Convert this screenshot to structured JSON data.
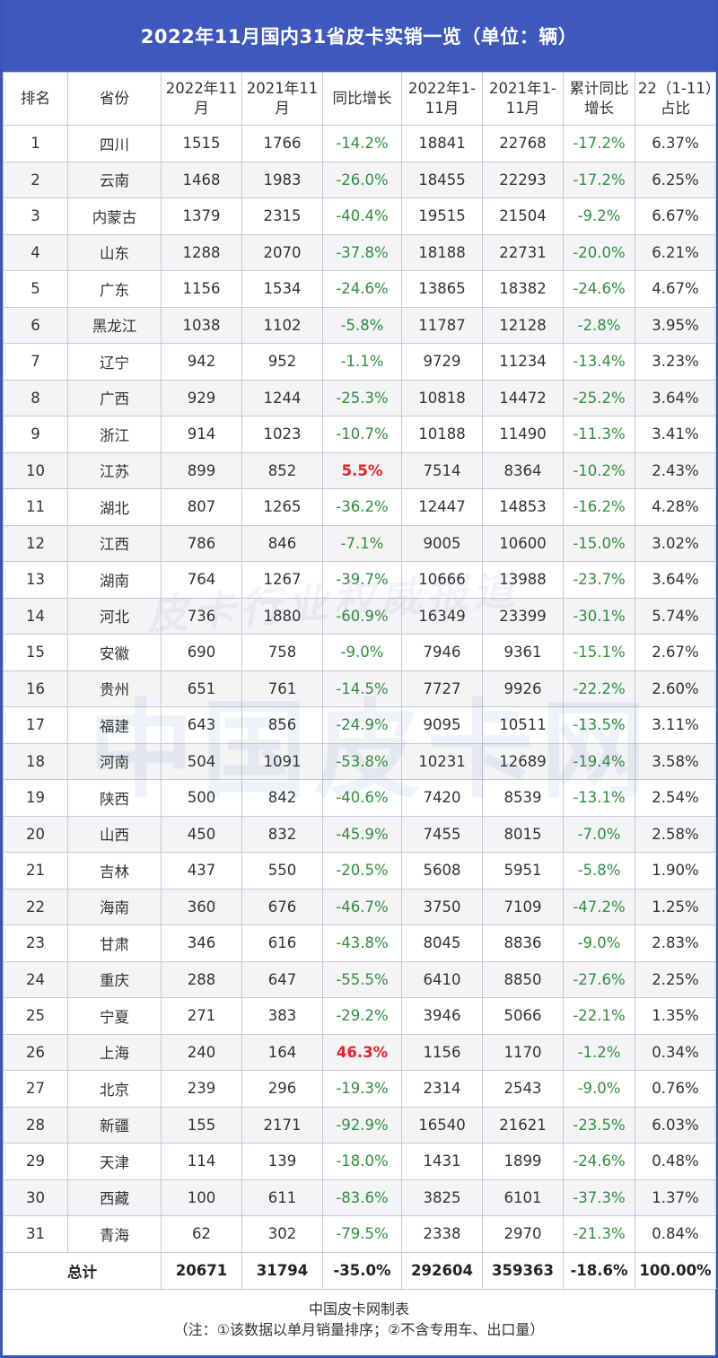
{
  "title": "2022年11月国内31省皮卡实销一览（单位：辆）",
  "headers": [
    "排名",
    "省份",
    "2022年11月",
    "2021年11月",
    "同比增长",
    "2022年1-11月",
    "2021年1-11月",
    "累计同比增长",
    "22（1-11）占比"
  ],
  "rows": [
    {
      "rank": "1",
      "province": "四川",
      "nov22": "1515",
      "nov21": "1766",
      "yoy": "-14.2%",
      "ytd22": "18841",
      "ytd21": "22768",
      "ytd_yoy": "-17.2%",
      "share": "6.37%"
    },
    {
      "rank": "2",
      "province": "云南",
      "nov22": "1468",
      "nov21": "1983",
      "yoy": "-26.0%",
      "ytd22": "18455",
      "ytd21": "22293",
      "ytd_yoy": "-17.2%",
      "share": "6.25%"
    },
    {
      "rank": "3",
      "province": "内蒙古",
      "nov22": "1379",
      "nov21": "2315",
      "yoy": "-40.4%",
      "ytd22": "19515",
      "ytd21": "21504",
      "ytd_yoy": "-9.2%",
      "share": "6.67%"
    },
    {
      "rank": "4",
      "province": "山东",
      "nov22": "1288",
      "nov21": "2070",
      "yoy": "-37.8%",
      "ytd22": "18188",
      "ytd21": "22731",
      "ytd_yoy": "-20.0%",
      "share": "6.21%"
    },
    {
      "rank": "5",
      "province": "广东",
      "nov22": "1156",
      "nov21": "1534",
      "yoy": "-24.6%",
      "ytd22": "13865",
      "ytd21": "18382",
      "ytd_yoy": "-24.6%",
      "share": "4.67%"
    },
    {
      "rank": "6",
      "province": "黑龙江",
      "nov22": "1038",
      "nov21": "1102",
      "yoy": "-5.8%",
      "ytd22": "11787",
      "ytd21": "12128",
      "ytd_yoy": "-2.8%",
      "share": "3.95%"
    },
    {
      "rank": "7",
      "province": "辽宁",
      "nov22": "942",
      "nov21": "952",
      "yoy": "-1.1%",
      "ytd22": "9729",
      "ytd21": "11234",
      "ytd_yoy": "-13.4%",
      "share": "3.23%"
    },
    {
      "rank": "8",
      "province": "广西",
      "nov22": "929",
      "nov21": "1244",
      "yoy": "-25.3%",
      "ytd22": "10818",
      "ytd21": "14472",
      "ytd_yoy": "-25.2%",
      "share": "3.64%"
    },
    {
      "rank": "9",
      "province": "浙江",
      "nov22": "914",
      "nov21": "1023",
      "yoy": "-10.7%",
      "ytd22": "10188",
      "ytd21": "11490",
      "ytd_yoy": "-11.3%",
      "share": "3.41%"
    },
    {
      "rank": "10",
      "province": "江苏",
      "nov22": "899",
      "nov21": "852",
      "yoy": "5.5%",
      "ytd22": "7514",
      "ytd21": "8364",
      "ytd_yoy": "-10.2%",
      "share": "2.43%"
    },
    {
      "rank": "11",
      "province": "湖北",
      "nov22": "807",
      "nov21": "1265",
      "yoy": "-36.2%",
      "ytd22": "12447",
      "ytd21": "14853",
      "ytd_yoy": "-16.2%",
      "share": "4.28%"
    },
    {
      "rank": "12",
      "province": "江西",
      "nov22": "786",
      "nov21": "846",
      "yoy": "-7.1%",
      "ytd22": "9005",
      "ytd21": "10600",
      "ytd_yoy": "-15.0%",
      "share": "3.02%"
    },
    {
      "rank": "13",
      "province": "湖南",
      "nov22": "764",
      "nov21": "1267",
      "yoy": "-39.7%",
      "ytd22": "10666",
      "ytd21": "13988",
      "ytd_yoy": "-23.7%",
      "share": "3.64%"
    },
    {
      "rank": "14",
      "province": "河北",
      "nov22": "736",
      "nov21": "1880",
      "yoy": "-60.9%",
      "ytd22": "16349",
      "ytd21": "23399",
      "ytd_yoy": "-30.1%",
      "share": "5.74%"
    },
    {
      "rank": "15",
      "province": "安徽",
      "nov22": "690",
      "nov21": "758",
      "yoy": "-9.0%",
      "ytd22": "7946",
      "ytd21": "9361",
      "ytd_yoy": "-15.1%",
      "share": "2.67%"
    },
    {
      "rank": "16",
      "province": "贵州",
      "nov22": "651",
      "nov21": "761",
      "yoy": "-14.5%",
      "ytd22": "7727",
      "ytd21": "9926",
      "ytd_yoy": "-22.2%",
      "share": "2.60%"
    },
    {
      "rank": "17",
      "province": "福建",
      "nov22": "643",
      "nov21": "856",
      "yoy": "-24.9%",
      "ytd22": "9095",
      "ytd21": "10511",
      "ytd_yoy": "-13.5%",
      "share": "3.11%"
    },
    {
      "rank": "18",
      "province": "河南",
      "nov22": "504",
      "nov21": "1091",
      "yoy": "-53.8%",
      "ytd22": "10231",
      "ytd21": "12689",
      "ytd_yoy": "-19.4%",
      "share": "3.58%"
    },
    {
      "rank": "19",
      "province": "陕西",
      "nov22": "500",
      "nov21": "842",
      "yoy": "-40.6%",
      "ytd22": "7420",
      "ytd21": "8539",
      "ytd_yoy": "-13.1%",
      "share": "2.54%"
    },
    {
      "rank": "20",
      "province": "山西",
      "nov22": "450",
      "nov21": "832",
      "yoy": "-45.9%",
      "ytd22": "7455",
      "ytd21": "8015",
      "ytd_yoy": "-7.0%",
      "share": "2.58%"
    },
    {
      "rank": "21",
      "province": "吉林",
      "nov22": "437",
      "nov21": "550",
      "yoy": "-20.5%",
      "ytd22": "5608",
      "ytd21": "5951",
      "ytd_yoy": "-5.8%",
      "share": "1.90%"
    },
    {
      "rank": "22",
      "province": "海南",
      "nov22": "360",
      "nov21": "676",
      "yoy": "-46.7%",
      "ytd22": "3750",
      "ytd21": "7109",
      "ytd_yoy": "-47.2%",
      "share": "1.25%"
    },
    {
      "rank": "23",
      "province": "甘肃",
      "nov22": "346",
      "nov21": "616",
      "yoy": "-43.8%",
      "ytd22": "8045",
      "ytd21": "8836",
      "ytd_yoy": "-9.0%",
      "share": "2.83%"
    },
    {
      "rank": "24",
      "province": "重庆",
      "nov22": "288",
      "nov21": "647",
      "yoy": "-55.5%",
      "ytd22": "6410",
      "ytd21": "8850",
      "ytd_yoy": "-27.6%",
      "share": "2.25%"
    },
    {
      "rank": "25",
      "province": "宁夏",
      "nov22": "271",
      "nov21": "383",
      "yoy": "-29.2%",
      "ytd22": "3946",
      "ytd21": "5066",
      "ytd_yoy": "-22.1%",
      "share": "1.35%"
    },
    {
      "rank": "26",
      "province": "上海",
      "nov22": "240",
      "nov21": "164",
      "yoy": "46.3%",
      "ytd22": "1156",
      "ytd21": "1170",
      "ytd_yoy": "-1.2%",
      "share": "0.34%"
    },
    {
      "rank": "27",
      "province": "北京",
      "nov22": "239",
      "nov21": "296",
      "yoy": "-19.3%",
      "ytd22": "2314",
      "ytd21": "2543",
      "ytd_yoy": "-9.0%",
      "share": "0.76%"
    },
    {
      "rank": "28",
      "province": "新疆",
      "nov22": "155",
      "nov21": "2171",
      "yoy": "-92.9%",
      "ytd22": "16540",
      "ytd21": "21621",
      "ytd_yoy": "-23.5%",
      "share": "6.03%"
    },
    {
      "rank": "29",
      "province": "天津",
      "nov22": "114",
      "nov21": "139",
      "yoy": "-18.0%",
      "ytd22": "1431",
      "ytd21": "1899",
      "ytd_yoy": "-24.6%",
      "share": "0.48%"
    },
    {
      "rank": "30",
      "province": "西藏",
      "nov22": "100",
      "nov21": "611",
      "yoy": "-83.6%",
      "ytd22": "3825",
      "ytd21": "6101",
      "ytd_yoy": "-37.3%",
      "share": "1.37%"
    },
    {
      "rank": "31",
      "province": "青海",
      "nov22": "62",
      "nov21": "302",
      "yoy": "-79.5%",
      "ytd22": "2338",
      "ytd21": "2970",
      "ytd_yoy": "-21.3%",
      "share": "0.84%"
    }
  ],
  "total": {
    "label": "总计",
    "nov22": "20671",
    "nov21": "31794",
    "yoy": "-35.0%",
    "ytd22": "292604",
    "ytd21": "359363",
    "ytd_yoy": "-18.6%",
    "share": "100.00%"
  },
  "footer": {
    "line1": "中国皮卡网制表",
    "line2": "（注：①该数据以单月销量排序；②不含专用车、出口量）"
  },
  "watermark": {
    "main": "中国皮卡网",
    "sub": "皮卡行业权威报道"
  },
  "colors": {
    "title_bg": "#3f58be",
    "negative": "#2f8f3b",
    "positive": "#e8202a"
  }
}
